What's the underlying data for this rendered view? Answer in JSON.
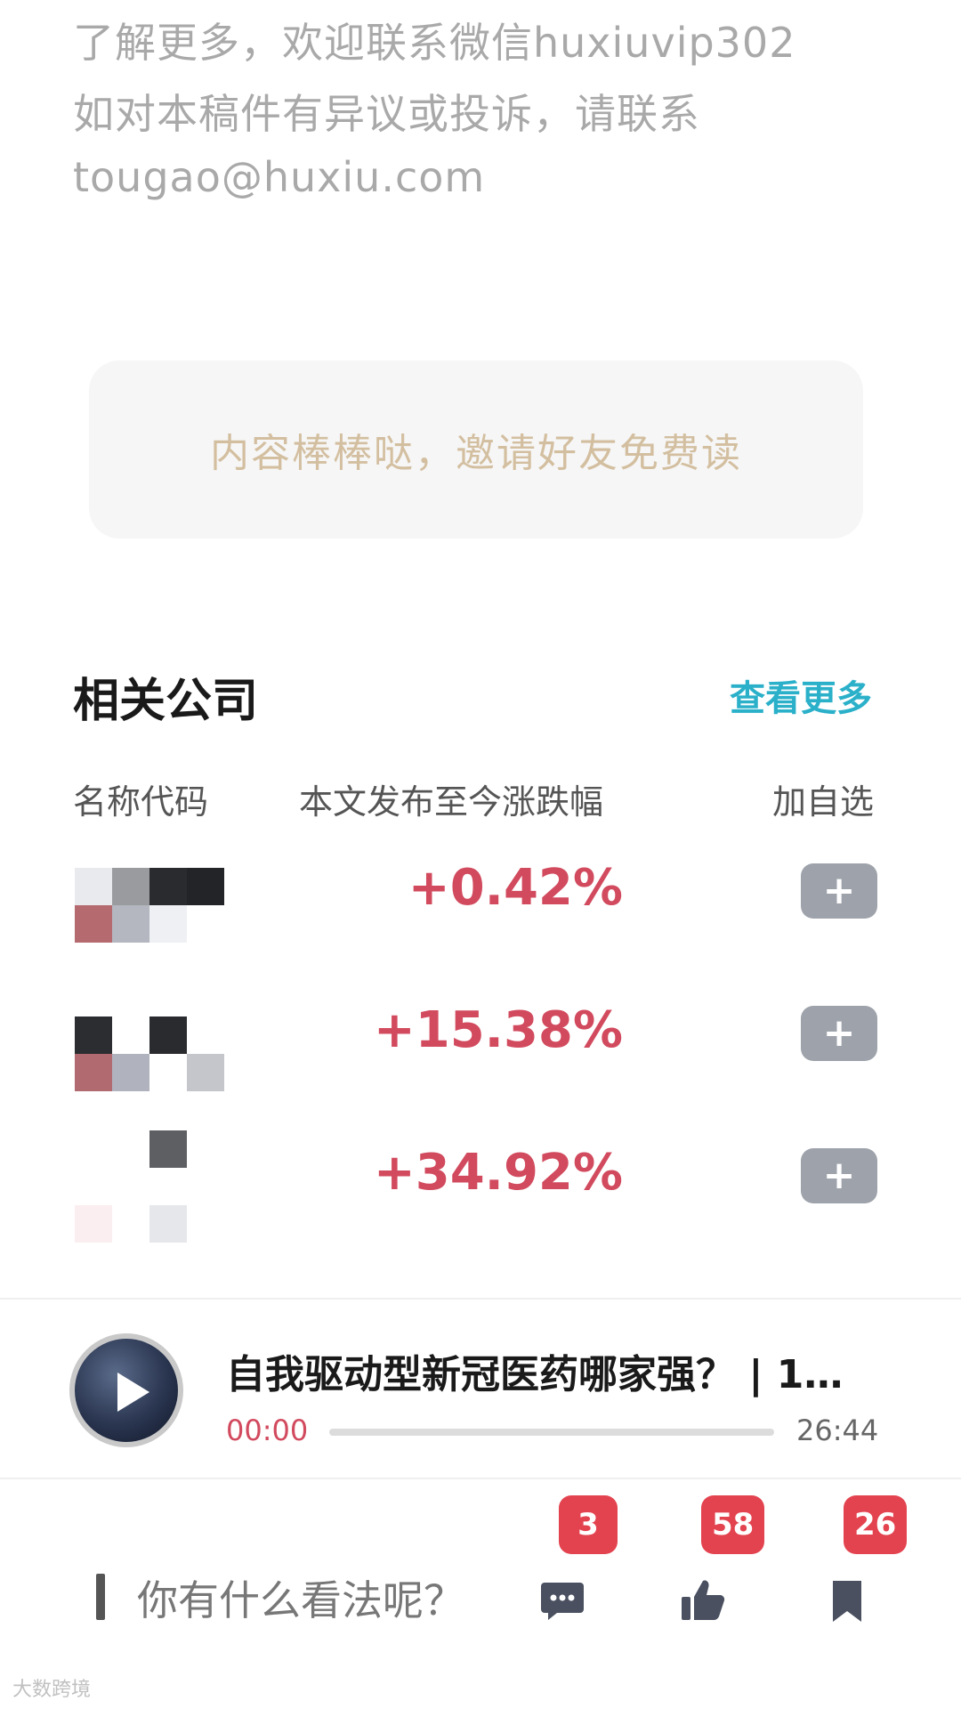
{
  "intro": {
    "line1": "了解更多，欢迎联系微信huxiuvip302",
    "line2": "如对本稿件有异议或投诉，请联系",
    "line3": "tougao@huxiu.com"
  },
  "invite": {
    "label": "内容棒棒哒，邀请好友免费读"
  },
  "related": {
    "title": "相关公司",
    "view_more": "查看更多",
    "columns": {
      "name": "名称代码",
      "change": "本文发布至今涨跌幅",
      "add": "加自选"
    },
    "rows": [
      {
        "change": "+0.42%",
        "add_label": "+"
      },
      {
        "change": "+15.38%",
        "add_label": "+"
      },
      {
        "change": "+34.92%",
        "add_label": "+"
      }
    ]
  },
  "audio": {
    "title": "自我驱动型新冠医药哪家强？ | 1…",
    "current_time": "00:00",
    "total_time": "26:44",
    "progress": 0
  },
  "bottom_bar": {
    "comment_prompt": "你有什么看法呢？",
    "comments_count": "3",
    "likes_count": "58",
    "bookmarks_count": "26"
  },
  "watermark": "大数跨境",
  "colors": {
    "accent": "#2bb0c9",
    "up": "#d24a5e",
    "badge": "#e3434f",
    "invite_text": "#d3bfa0"
  }
}
